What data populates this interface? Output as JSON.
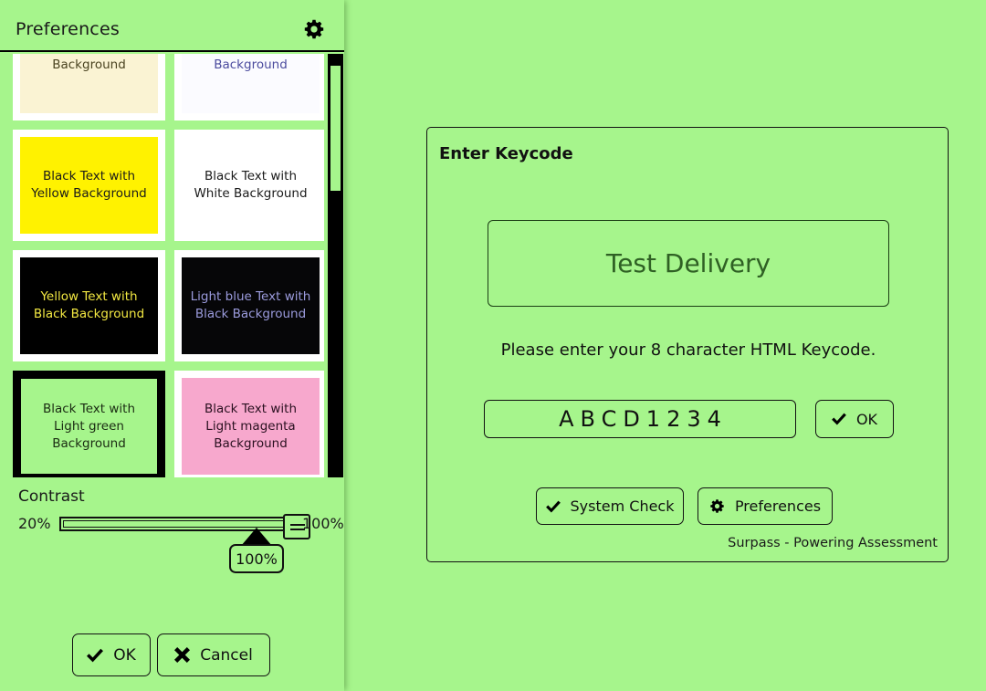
{
  "theme": {
    "page_background": "#A6F58C",
    "panel_background": "#A6F58C",
    "text_color": "#111111",
    "border_color": "#111111"
  },
  "preferences_panel": {
    "title": "Preferences",
    "gear_icon": "gear-icon",
    "swatches": [
      {
        "label": "Background",
        "bg": "#FAF3D3",
        "fg": "#4a4320",
        "selected": false,
        "clipped": true,
        "name": "swatch-dark-text-cream-background"
      },
      {
        "label": "Background",
        "bg": "#FBFBFF",
        "fg": "#4b4b9e",
        "selected": false,
        "clipped": true,
        "name": "swatch-blue-text-white-background"
      },
      {
        "label": "Black Text with Yellow Background",
        "bg": "#FFF200",
        "fg": "#1a1a1a",
        "selected": false,
        "clipped": false,
        "name": "swatch-black-text-yellow-background"
      },
      {
        "label": "Black Text with White Background",
        "bg": "#FFFFFF",
        "fg": "#1a1a1a",
        "selected": false,
        "clipped": false,
        "name": "swatch-black-text-white-background"
      },
      {
        "label": "Yellow Text with Black Background",
        "bg": "#000000",
        "fg": "#F2E842",
        "selected": false,
        "clipped": false,
        "name": "swatch-yellow-text-black-background"
      },
      {
        "label": "Light blue Text with Black Background",
        "bg": "#060608",
        "fg": "#9B9BDD",
        "selected": false,
        "clipped": false,
        "name": "swatch-light-blue-text-black-background"
      },
      {
        "label": "Black Text with Light green Background",
        "bg": "#A6F58C",
        "fg": "#1a2b12",
        "selected": true,
        "clipped": false,
        "name": "swatch-black-text-light-green-background"
      },
      {
        "label": "Black Text with Light magenta Background",
        "bg": "#F7A8CD",
        "fg": "#2a1020",
        "selected": false,
        "clipped": false,
        "name": "swatch-black-text-light-magenta-background"
      }
    ],
    "contrast": {
      "label": "Contrast",
      "min_label": "20%",
      "max_label": "100%",
      "value": 100,
      "tooltip": "100%"
    },
    "ok_label": "OK",
    "ok_icon": "checkmark-icon",
    "cancel_label": "Cancel",
    "cancel_icon": "cross-icon"
  },
  "keycode_dialog": {
    "heading": "Enter Keycode",
    "test_delivery_label": "Test Delivery",
    "instruction": "Please enter your 8 character HTML Keycode.",
    "keycode_value": "ABCD1234",
    "keycode_placeholder": "",
    "ok_label": "OK",
    "ok_icon": "checkmark-icon",
    "system_check_label": "System Check",
    "system_check_icon": "checkmark-icon",
    "preferences_label": "Preferences",
    "preferences_icon": "gear-icon",
    "brand": "Surpass - Powering Assessment"
  }
}
